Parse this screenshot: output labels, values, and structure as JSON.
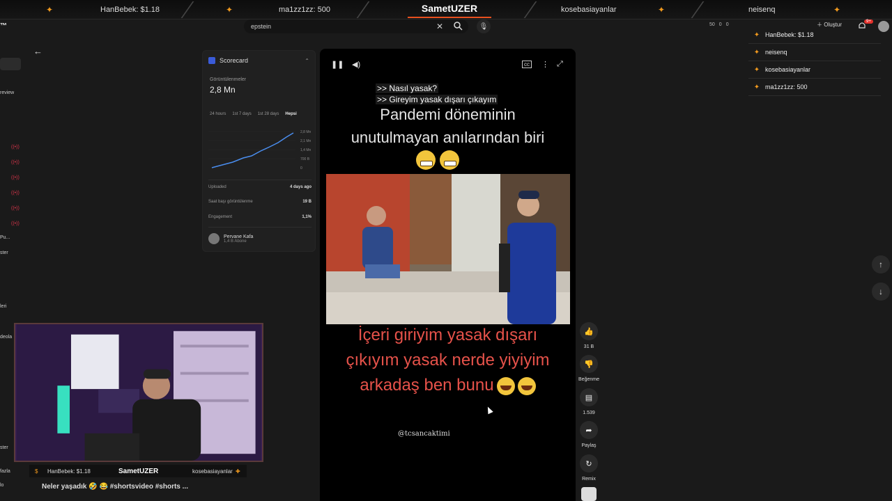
{
  "overlay": {
    "brand": "SametUZER",
    "ticker": [
      "HanBebek: $1.18",
      "ma1zz1zz: 500",
      "kosebasiayanlar",
      "neisenq"
    ]
  },
  "header": {
    "search_value": "epstein",
    "stats": [
      "50",
      "0",
      "0"
    ],
    "create_label": "Oluştur",
    "notif_count": "9+"
  },
  "sidebar": {
    "logo": "™",
    "fragments": [
      "review",
      "Pu...",
      "ster",
      "leri",
      "deola",
      "ster",
      "fazla",
      "lo"
    ]
  },
  "scorecard": {
    "title": "Scorecard",
    "views_label": "Görüntülenmeler",
    "views_value": "2,8 Mn",
    "tabs": [
      "24 hours",
      "1st 7 days",
      "1st 28 days",
      "Hepsi"
    ],
    "y_ticks": [
      "2,8 Mn",
      "2,1 Mn",
      "1,4 Mn",
      "700 B",
      "0"
    ],
    "rows": [
      {
        "label": "Uploaded",
        "value": "4 days ago"
      },
      {
        "label": "Saat başı görüntülenme",
        "value": "19 B"
      },
      {
        "label": "Engagement",
        "value": "1,1%"
      }
    ],
    "channel_name": "Pervane Kafa",
    "channel_subs": "1,4 B Abone"
  },
  "video": {
    "prompt_lines": [
      ">> Nasıl yasak?",
      ">> Gireyim yasak dışarı çıkayım"
    ],
    "title_lines": [
      "Pandemi döneminin",
      "unutulmayan anılarından biri"
    ],
    "red_lines": [
      "İçeri giriyim yasak dışarı",
      "çıkıyım yasak nerde yiyiyim",
      "arkadaş ben bunu"
    ],
    "handle": "@tcsancaktimi"
  },
  "actions": {
    "like_count": "31 B",
    "dislike_label": "Beğenme",
    "comment_count": "1.539",
    "share_label": "Paylaş",
    "remix_label": "Remix"
  },
  "chat": [
    {
      "name": "HanBebek: $1.18"
    },
    {
      "name": "neisenq"
    },
    {
      "name": "kosebasiayanlar"
    },
    {
      "name": "ma1zz1zz: 500"
    }
  ],
  "cam": {
    "left": "HanBebek: $1.18",
    "brand": "SametUZER",
    "right": "kosebasiayanlar"
  },
  "below": {
    "caption": "Neler yaşadık 🤣 😂 #shortsvideo #shorts ..."
  }
}
